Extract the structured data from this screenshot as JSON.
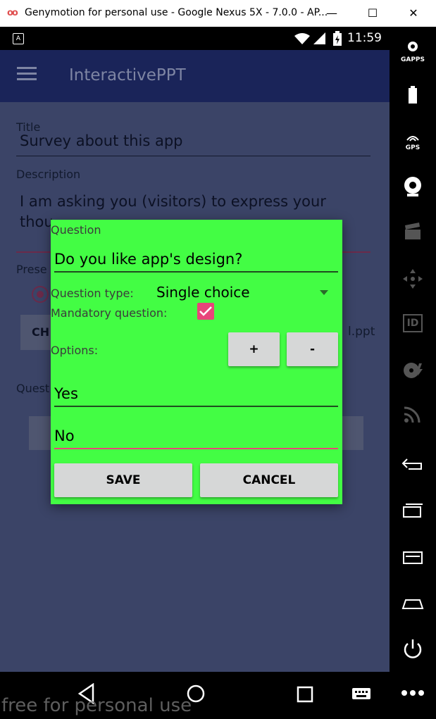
{
  "window": {
    "logo": "oo",
    "title": "Genymotion for personal use - Google Nexus 5X - 7.0.0 - AP...",
    "minimize": "—",
    "maximize": "☐",
    "close": "✕"
  },
  "statusbar": {
    "notification_icon": "A",
    "time": "11:59"
  },
  "toolbar": {
    "gapps_label": "GAPPS",
    "gps_label": "GPS",
    "id_label": "ID"
  },
  "app": {
    "title": "InteractivePPT",
    "form": {
      "title_label": "Title",
      "title_value": "Survey about this app",
      "description_label": "Description",
      "description_line1": "I am asking you (visitors) to express your",
      "description_line2": "thou",
      "presentation_label": "Prese",
      "choose_button_partial": "CH",
      "file_name_partial": "l.ppt",
      "questions_label_partial": "Quest"
    }
  },
  "dialog": {
    "question_label": "Question",
    "question_value": "Do you like app's design?",
    "question_type_label": "Question type:",
    "question_type_value": "Single choice",
    "mandatory_label": "Mandatory question:",
    "mandatory_checked": true,
    "options_label": "Options:",
    "add_option": "+",
    "remove_option": "-",
    "options": [
      "Yes",
      "No"
    ],
    "save": "SAVE",
    "cancel": "CANCEL"
  },
  "watermark": "free for personal use",
  "colors": {
    "dialog_bg": "#43fd44",
    "accent": "#e8457a",
    "appbar": "#1a2459"
  }
}
